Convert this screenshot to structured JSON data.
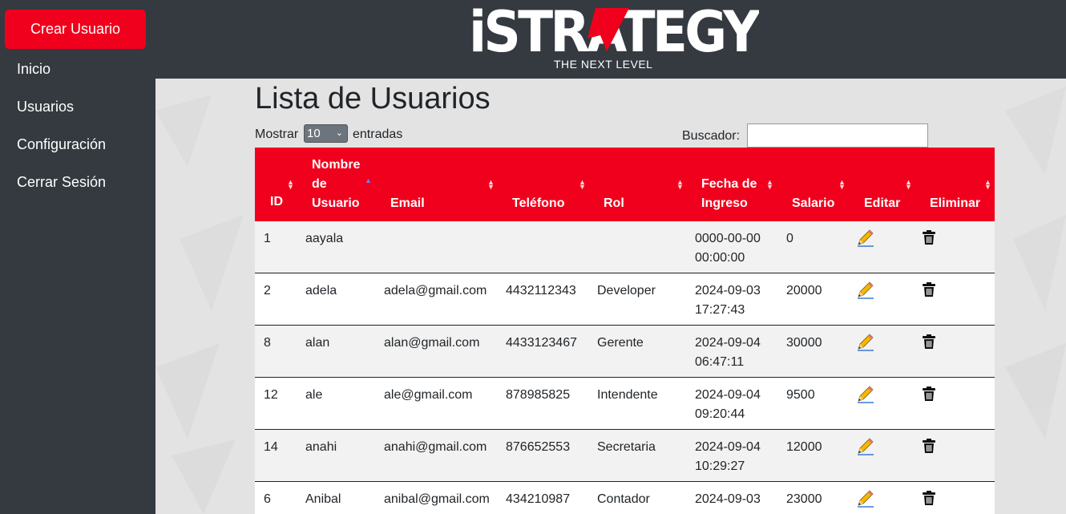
{
  "brand": {
    "logo_text": "iSTRATEGY",
    "tagline": "THE NEXT LEVEL"
  },
  "sidebar": {
    "create_button": "Crear Usuario",
    "items": [
      {
        "label": "Inicio"
      },
      {
        "label": "Usuarios"
      },
      {
        "label": "Configuración"
      },
      {
        "label": "Cerrar Sesión"
      }
    ]
  },
  "main": {
    "title": "Lista de Usuarios",
    "show_label": "Mostrar",
    "page_size": "10",
    "entries_label": "entradas",
    "search_label": "Buscador:",
    "search_value": ""
  },
  "table": {
    "headers": {
      "id": "ID",
      "username_1": "Nombre",
      "username_2": "de",
      "username_3": "Usuario",
      "email": "Email",
      "phone": "Teléfono",
      "role": "Rol",
      "date_1": "Fecha de",
      "date_2": "Ingreso",
      "salary": "Salario",
      "edit": "Editar",
      "delete": "Eliminar"
    },
    "sorted_column": "Nombre de Usuario",
    "rows": [
      {
        "id": "1",
        "username": "aayala",
        "email": "",
        "phone": "",
        "role": "",
        "date": "0000-00-00",
        "time": "00:00:00",
        "salary": "0"
      },
      {
        "id": "2",
        "username": "adela",
        "email": "adela@gmail.com",
        "phone": "4432112343",
        "role": "Developer",
        "date": "2024-09-03",
        "time": "17:27:43",
        "salary": "20000"
      },
      {
        "id": "8",
        "username": "alan",
        "email": "alan@gmail.com",
        "phone": "4433123467",
        "role": "Gerente",
        "date": "2024-09-04",
        "time": "06:47:11",
        "salary": "30000"
      },
      {
        "id": "12",
        "username": "ale",
        "email": "ale@gmail.com",
        "phone": "878985825",
        "role": "Intendente",
        "date": "2024-09-04",
        "time": "09:20:44",
        "salary": "9500"
      },
      {
        "id": "14",
        "username": "anahi",
        "email": "anahi@gmail.com",
        "phone": "876652553",
        "role": "Secretaria",
        "date": "2024-09-04",
        "time": "10:29:27",
        "salary": "12000"
      },
      {
        "id": "6",
        "username": "Anibal",
        "email": "anibal@gmail.com",
        "phone": "434210987",
        "role": "Contador",
        "date": "2024-09-03",
        "time": "",
        "salary": "23000"
      }
    ]
  },
  "colors": {
    "accent": "#f0001c",
    "sidebar_bg": "#343a40",
    "content_bg": "#e3e3e3"
  },
  "icons": {
    "edit": "pencil-icon",
    "delete": "trash-icon",
    "sort": "sort-icon"
  }
}
